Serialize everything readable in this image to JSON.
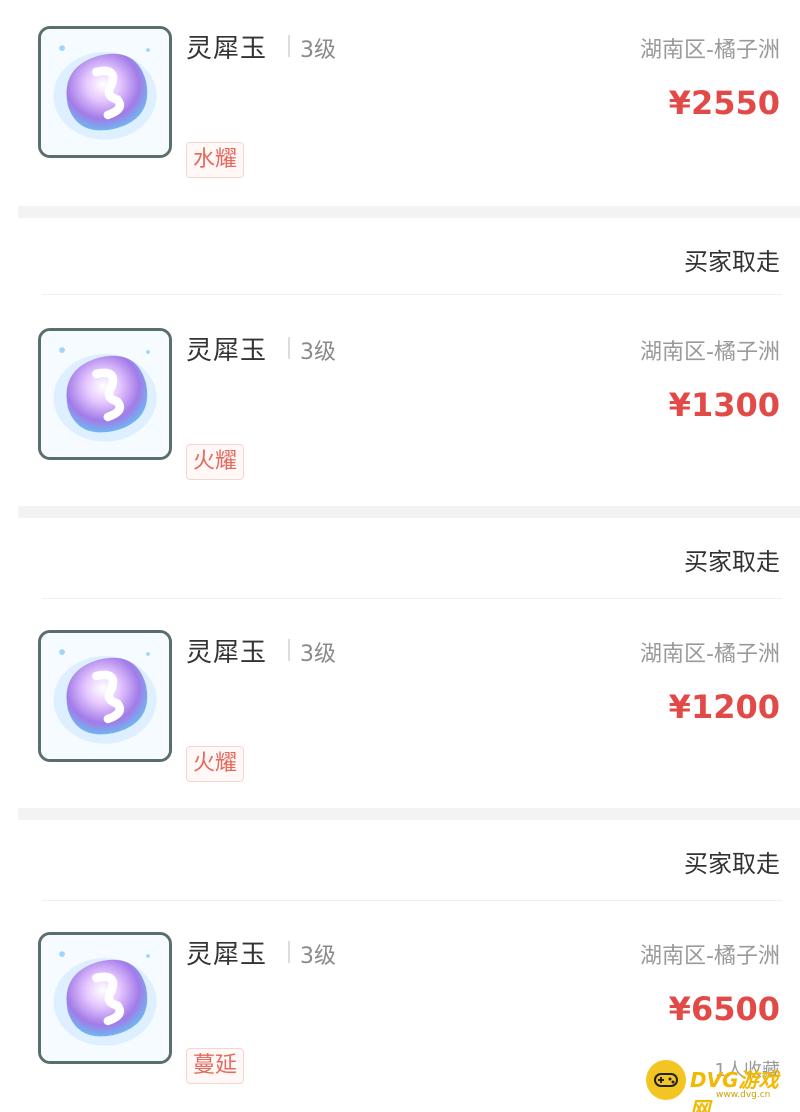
{
  "listings": [
    {
      "name": "灵犀玉",
      "level": "3级",
      "location": "湖南区-橘子洲",
      "price": "¥2550",
      "tag": "水耀",
      "status": ""
    },
    {
      "name": "灵犀玉",
      "level": "3级",
      "location": "湖南区-橘子洲",
      "price": "¥1300",
      "tag": "火耀",
      "status": "买家取走"
    },
    {
      "name": "灵犀玉",
      "level": "3级",
      "location": "湖南区-橘子洲",
      "price": "¥1200",
      "tag": "火耀",
      "status": "买家取走"
    },
    {
      "name": "灵犀玉",
      "level": "3级",
      "location": "湖南区-橘子洲",
      "price": "¥6500",
      "tag": "蔓延",
      "status": "买家取走",
      "favorites": "1人收藏"
    }
  ],
  "watermark": {
    "brand": "DVG游戏网",
    "sub": "www.dvg.cn"
  },
  "colors": {
    "price": "#e24a48",
    "tag": "#e46a5e",
    "gem": "#b58cf0"
  }
}
